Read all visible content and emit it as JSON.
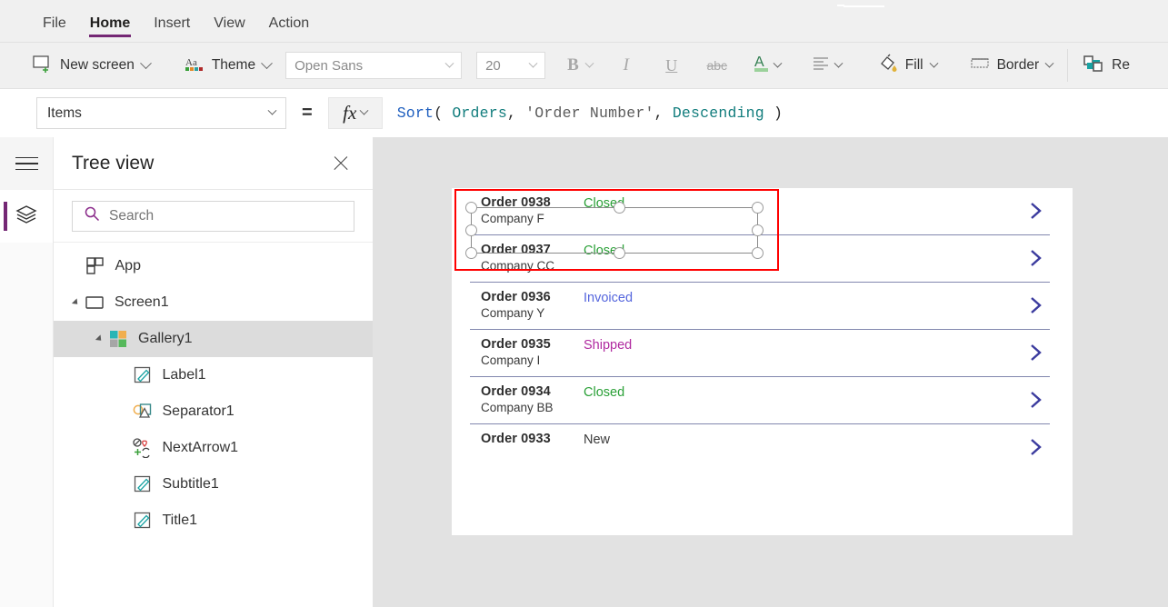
{
  "menubar": {
    "items": [
      {
        "label": "File",
        "active": false
      },
      {
        "label": "Home",
        "active": true
      },
      {
        "label": "Insert",
        "active": false
      },
      {
        "label": "View",
        "active": false
      },
      {
        "label": "Action",
        "active": false
      }
    ]
  },
  "ribbon": {
    "new_screen": "New screen",
    "theme": "Theme",
    "font_family": "Open Sans",
    "font_size": "20",
    "bold": "B",
    "italic": "I",
    "underline": "U",
    "strikethrough": "abc",
    "font_color": "A",
    "align": "align",
    "fill": "Fill",
    "border": "Border",
    "reorder": "Re"
  },
  "formula": {
    "property": "Items",
    "equals": "=",
    "fx": "fx",
    "tokens": [
      {
        "text": "Sort",
        "type": "fn"
      },
      {
        "text": "( ",
        "type": "punc"
      },
      {
        "text": "Orders",
        "type": "id"
      },
      {
        "text": ", ",
        "type": "punc"
      },
      {
        "text": "'Order Number'",
        "type": "str"
      },
      {
        "text": ", ",
        "type": "punc"
      },
      {
        "text": "Descending",
        "type": "id"
      },
      {
        "text": " )",
        "type": "punc"
      }
    ]
  },
  "rail": {
    "hamburger": "hamburger-menu",
    "tree_view_icon": "layers-icon"
  },
  "treeview": {
    "title": "Tree view",
    "close": "close",
    "search": {
      "value": "",
      "placeholder": "Search"
    },
    "items": [
      {
        "label": "App",
        "indent": 0,
        "twisty": "none",
        "icon": "app",
        "selected": false
      },
      {
        "label": "Screen1",
        "indent": 0,
        "twisty": "expanded",
        "icon": "screen",
        "selected": false
      },
      {
        "label": "Gallery1",
        "indent": 1,
        "twisty": "expanded",
        "icon": "gallery",
        "selected": true
      },
      {
        "label": "Label1",
        "indent": 2,
        "twisty": "none",
        "icon": "label",
        "selected": false
      },
      {
        "label": "Separator1",
        "indent": 2,
        "twisty": "none",
        "icon": "separator",
        "selected": false
      },
      {
        "label": "NextArrow1",
        "indent": 2,
        "twisty": "none",
        "icon": "nextarrow",
        "selected": false
      },
      {
        "label": "Subtitle1",
        "indent": 2,
        "twisty": "none",
        "icon": "label",
        "selected": false
      },
      {
        "label": "Title1",
        "indent": 2,
        "twisty": "none",
        "icon": "label",
        "selected": false
      }
    ]
  },
  "gallery": {
    "selected_index": 0,
    "status_colors": {
      "Closed": "#2aa037",
      "Invoiced": "#5566dd",
      "Shipped": "#b02aa0",
      "New": "#3a3a3a"
    },
    "chevron_color": "#3b3b9e",
    "separator_color": "#8287ae",
    "rows": [
      {
        "title": "Order 0938",
        "subtitle": "Company F",
        "status": "Closed"
      },
      {
        "title": "Order 0937",
        "subtitle": "Company CC",
        "status": "Closed"
      },
      {
        "title": "Order 0936",
        "subtitle": "Company Y",
        "status": "Invoiced"
      },
      {
        "title": "Order 0935",
        "subtitle": "Company I",
        "status": "Shipped"
      },
      {
        "title": "Order 0934",
        "subtitle": "Company BB",
        "status": "Closed"
      },
      {
        "title": "Order 0933",
        "subtitle": "",
        "status": "New"
      }
    ]
  },
  "colors": {
    "accent": "#742774",
    "canvas_bg": "#e2e2e2",
    "selection": "#ff0000"
  }
}
